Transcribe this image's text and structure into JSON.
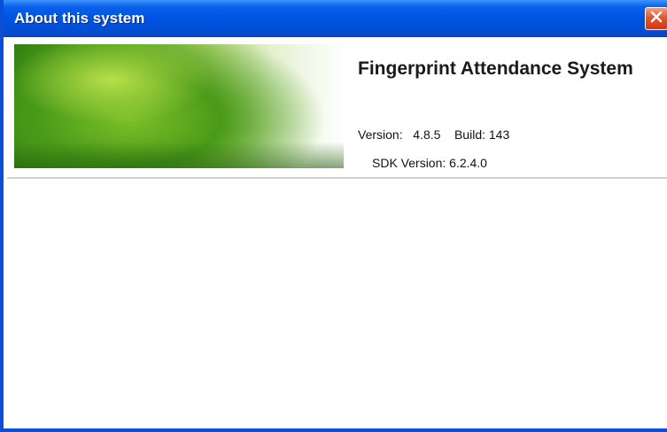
{
  "window": {
    "title": "About this system"
  },
  "header": {
    "app_name": "Fingerprint Attendance System",
    "version_label": "Version:",
    "version_value": "4.8.5",
    "build_label": "Build:",
    "build_value": "143",
    "sdk_label": "SDK Version:",
    "sdk_value": "6.2.4.0"
  },
  "icons": {
    "close": "close-icon"
  },
  "colors": {
    "titlebar": "#0054e3",
    "close_button": "#e2552c",
    "banner_green": "#58a820"
  }
}
